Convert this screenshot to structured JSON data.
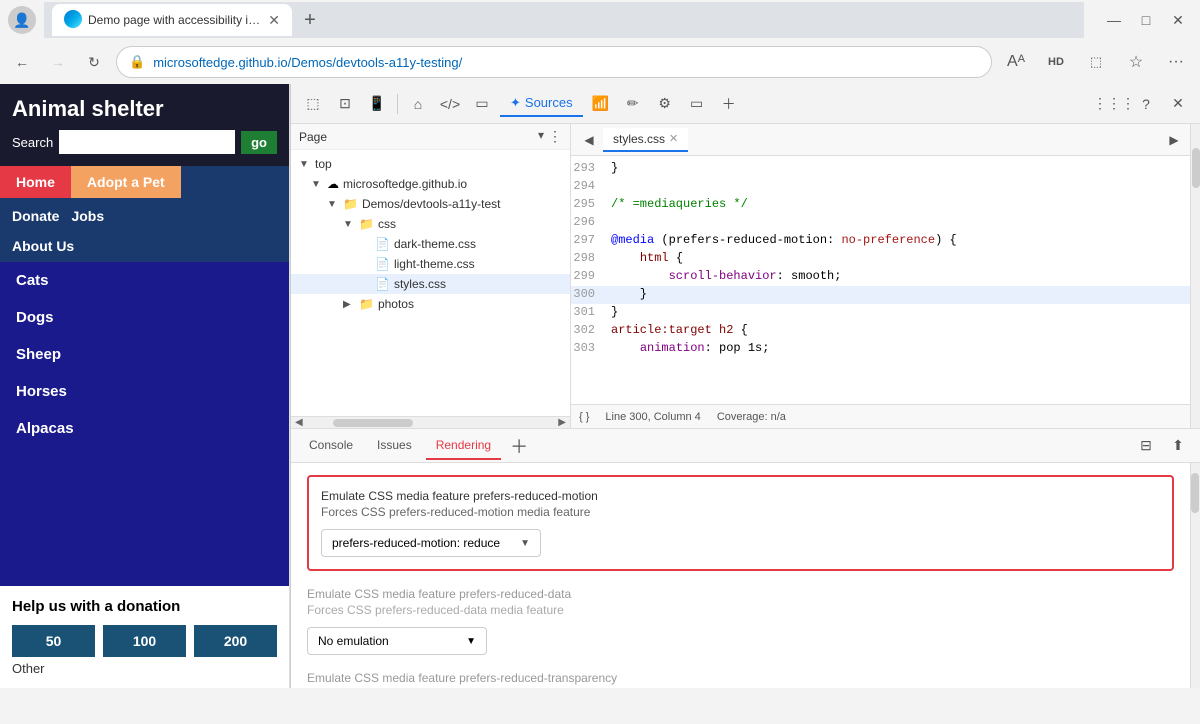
{
  "browser": {
    "tab_title": "Demo page with accessibility issu",
    "tab_favicon": "edge",
    "new_tab_label": "+",
    "address_bar": {
      "url_base": "microsoftedge.github.io",
      "url_path": "/Demos/devtools-a11y-testing/",
      "lock_icon": "🔒"
    },
    "window_controls": {
      "minimize": "—",
      "maximize": "□",
      "close": "✕"
    },
    "nav_back": "←",
    "nav_forward": "→",
    "nav_refresh": "↻",
    "addr_star": "☆",
    "addr_more": "···"
  },
  "website": {
    "title": "Animal shelter",
    "search_label": "Search",
    "search_placeholder": "",
    "search_btn": "go",
    "nav": {
      "home": "Home",
      "adopt": "Adopt a Pet",
      "donate": "Donate",
      "jobs": "Jobs",
      "about": "About Us"
    },
    "animals": [
      "Cats",
      "Dogs",
      "Sheep",
      "Horses",
      "Alpacas"
    ],
    "donation": {
      "title": "Help us with a donation",
      "amounts": [
        "50",
        "100",
        "200"
      ],
      "other": "Other"
    }
  },
  "devtools": {
    "toolbar_icons": [
      "cursor",
      "inspect",
      "device",
      "home",
      "code",
      "mobile",
      "sources",
      "wifi",
      "pen",
      "settings",
      "window",
      "plus",
      "more",
      "help",
      "close"
    ],
    "sources_tab": "Sources",
    "page_panel": {
      "title": "Page",
      "tree": [
        {
          "label": "top",
          "indent": 0,
          "type": "arrow",
          "expanded": true
        },
        {
          "label": "microsoftedge.github.io",
          "indent": 1,
          "type": "cloud",
          "expanded": true
        },
        {
          "label": "Demos/devtools-a11y-test",
          "indent": 2,
          "type": "folder",
          "expanded": true
        },
        {
          "label": "css",
          "indent": 3,
          "type": "folder",
          "expanded": true
        },
        {
          "label": "dark-theme.css",
          "indent": 4,
          "type": "file"
        },
        {
          "label": "light-theme.css",
          "indent": 4,
          "type": "file"
        },
        {
          "label": "styles.css",
          "indent": 4,
          "type": "file",
          "selected": true
        },
        {
          "label": "photos",
          "indent": 3,
          "type": "folder",
          "collapsed": true
        }
      ]
    },
    "code_file": "styles.css",
    "code_lines": [
      {
        "num": "293",
        "content": "}"
      },
      {
        "num": "294",
        "content": ""
      },
      {
        "num": "295",
        "content": "/* =mediaqueries */",
        "type": "comment"
      },
      {
        "num": "296",
        "content": ""
      },
      {
        "num": "297",
        "content": "@media (prefers-reduced-motion: no-preference) {",
        "type": "media"
      },
      {
        "num": "298",
        "content": "    html {",
        "type": "selector"
      },
      {
        "num": "299",
        "content": "        scroll-behavior: smooth;",
        "type": "property"
      },
      {
        "num": "300",
        "content": "    }"
      },
      {
        "num": "301",
        "content": "}"
      },
      {
        "num": "302",
        "content": "article:target h2 {",
        "type": "selector"
      },
      {
        "num": "303",
        "content": "    animation: pop 1s;",
        "type": "property"
      }
    ],
    "status_bar": {
      "bracket": "{ }",
      "position": "Line 300, Column 4",
      "coverage": "Coverage: n/a"
    },
    "bottom_tabs": {
      "console": "Console",
      "issues": "Issues",
      "rendering": "Rendering",
      "active": "Rendering"
    },
    "rendering": {
      "section1": {
        "label": "Emulate CSS media feature prefers-reduced-motion",
        "sublabel": "Forces CSS prefers-reduced-motion media feature",
        "select_value": "prefers-reduced-motion: reduce",
        "has_border": true
      },
      "section2": {
        "label": "Emulate CSS media feature prefers-reduced-data",
        "sublabel": "Forces CSS prefers-reduced-data media feature",
        "select_value": "No emulation"
      },
      "section3": {
        "label": "Emulate CSS media feature prefers-reduced-transparency"
      }
    }
  },
  "colors": {
    "nav_blue": "#1a1a8c",
    "site_header_bg": "#1a1a2e",
    "home_red": "#e63946",
    "adopt_orange": "#f4a261",
    "go_green": "#1e7e34",
    "donation_btn_bg": "#1a5276",
    "rendering_border": "#e63946",
    "active_tab_color": "#e63946",
    "sources_blue": "#1a73e8",
    "edge_blue": "#0078d4"
  }
}
